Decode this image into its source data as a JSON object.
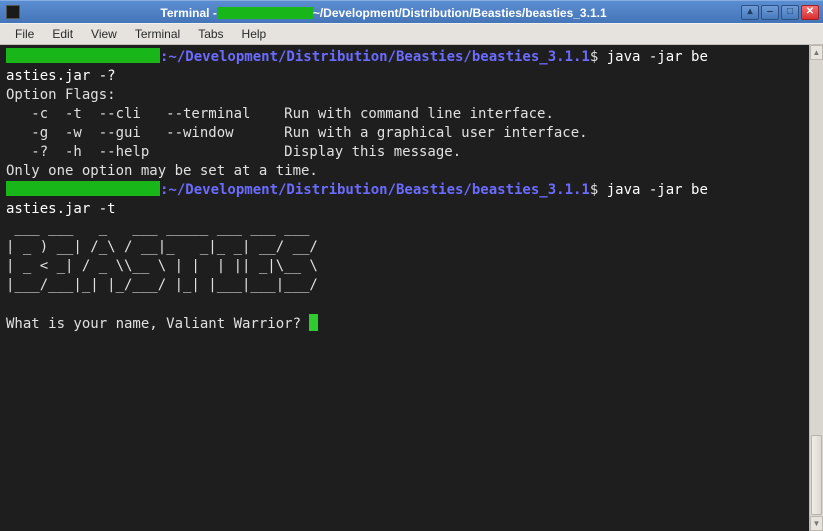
{
  "titlebar": {
    "prefix": "Terminal - ",
    "suffix": "~/Development/Distribution/Beasties/beasties_3.1.1"
  },
  "menubar": [
    "File",
    "Edit",
    "View",
    "Terminal",
    "Tabs",
    "Help"
  ],
  "prompt": {
    "path": ":~/Development/Distribution/Beasties/beasties_3.1.1",
    "sigil": "$ "
  },
  "lines": {
    "cmd1": "java -jar be",
    "cmd1b": "asties.jar -?",
    "opt_header": "Option Flags:",
    "opt1": "   -c  -t  --cli   --terminal    Run with command line interface.",
    "opt2": "   -g  -w  --gui   --window      Run with a graphical user interface.",
    "opt3": "   -?  -h  --help                Display this message.",
    "opt_footer": "Only one option may be set at a time.",
    "cmd2": "java -jar be",
    "cmd2b": "asties.jar -t",
    "ascii1": " ___ ___   _   ___ _____ ___ ___ ___ ",
    "ascii2": "| _ ) __| /_\\ / __|_   _|_ _| __/ __/",
    "ascii3": "| _ < _| / _ \\\\__ \\ | |  | || _|\\__ \\",
    "ascii4": "|___/___|_| |_/___/ |_| |___|___|___/",
    "question": "What is your name, Valiant Warrior? "
  }
}
